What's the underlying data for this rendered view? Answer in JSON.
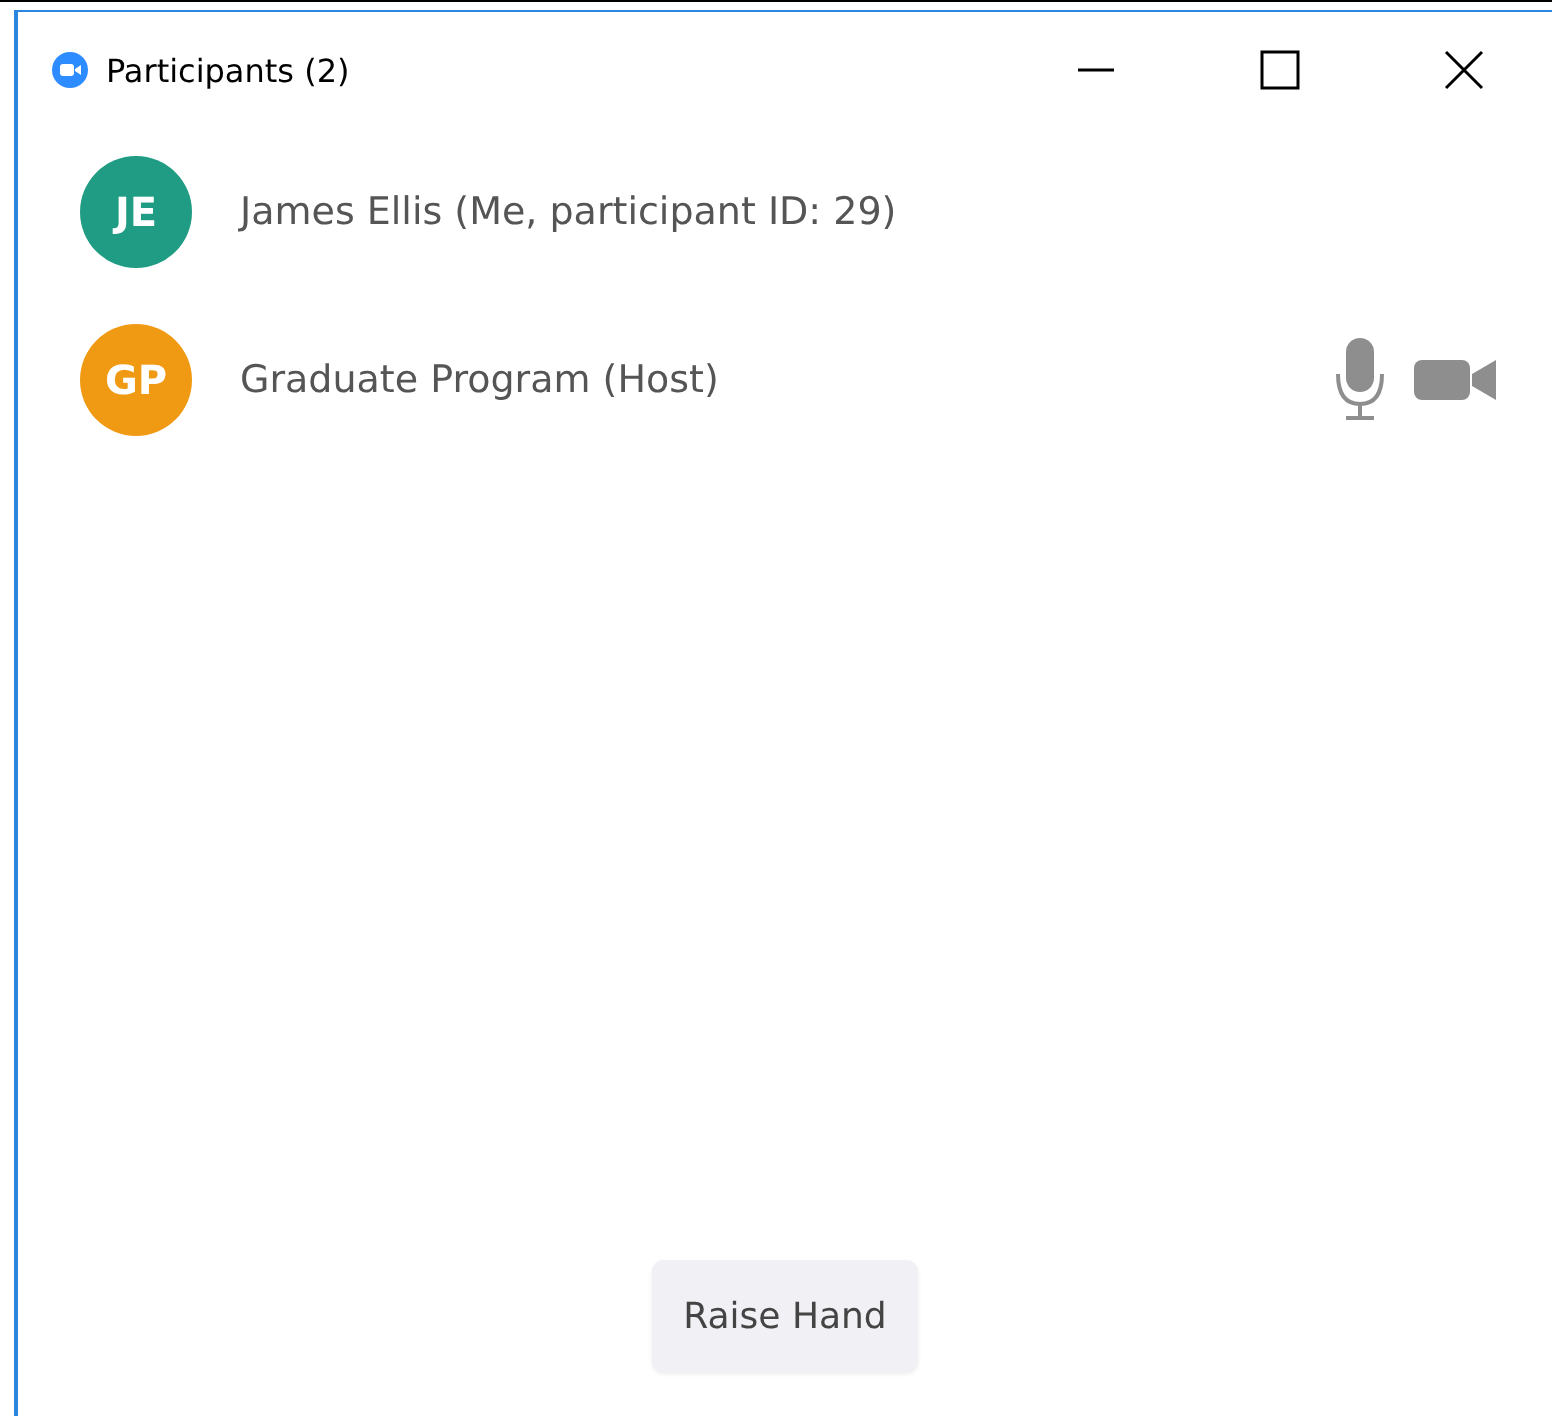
{
  "window": {
    "title": "Participants (2)"
  },
  "participants": [
    {
      "initials": "JE",
      "color": "#1f9c83",
      "name": "James Ellis (Me, participant ID: 29)",
      "mic": false,
      "video": false
    },
    {
      "initials": "GP",
      "color": "#f09a14",
      "name": "Graduate Program (Host)",
      "mic": true,
      "video": true
    }
  ],
  "raise_hand": {
    "label": "Raise Hand"
  }
}
